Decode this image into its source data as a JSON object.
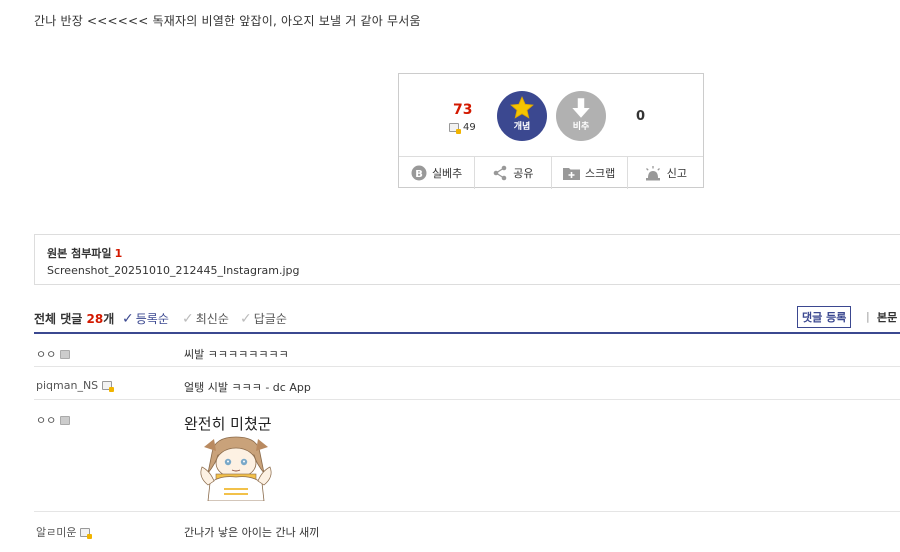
{
  "post": {
    "body_text": "간나 반장 <<<<<< 독재자의 비열한 앞잡이, 아오지 보낼 거 같아 무서움"
  },
  "vote": {
    "up_count": "73",
    "fixed_count": "49",
    "up_label": "개념",
    "down_label": "비추",
    "down_count": "0",
    "tools": [
      {
        "label": "실베추",
        "icon": "b-badge-icon"
      },
      {
        "label": "공유",
        "icon": "share-icon"
      },
      {
        "label": "스크랩",
        "icon": "folder-plus-icon"
      },
      {
        "label": "신고",
        "icon": "siren-icon"
      }
    ]
  },
  "attachments": {
    "title": "원본 첨부파일",
    "count": "1",
    "files": [
      "Screenshot_20251010_212445_Instagram.jpg"
    ]
  },
  "comments": {
    "total_label": "전체 댓글",
    "total_count": "28",
    "total_suffix": "개",
    "sort": [
      "등록순",
      "최신순",
      "답글순"
    ],
    "active_sort": "등록순",
    "register_label": "댓글 등록",
    "separator": "|",
    "to_body_label": "본문",
    "items": [
      {
        "nick": "ㅇㅇ",
        "text": "씨발 ㅋㅋㅋㅋㅋㅋㅋㅋ",
        "icon": "mobile-icon"
      },
      {
        "nick": "piqman_NS",
        "text": "얼탱 시발 ㅋㅋㅋ - dc App",
        "icon": "fixed-nick-icon"
      },
      {
        "nick": "ㅇㅇ",
        "text": "완전히 미쳤군",
        "icon": "mobile-icon",
        "has_dccon": true
      },
      {
        "nick": "알ㄹ미운",
        "text": "간나가 낳은 아이는 간나 새끼",
        "icon": "fixed-nick-icon"
      }
    ]
  },
  "colors": {
    "accent": "#3b4890",
    "count_red": "#d31900",
    "downvote_gray": "#b1b1b1"
  }
}
